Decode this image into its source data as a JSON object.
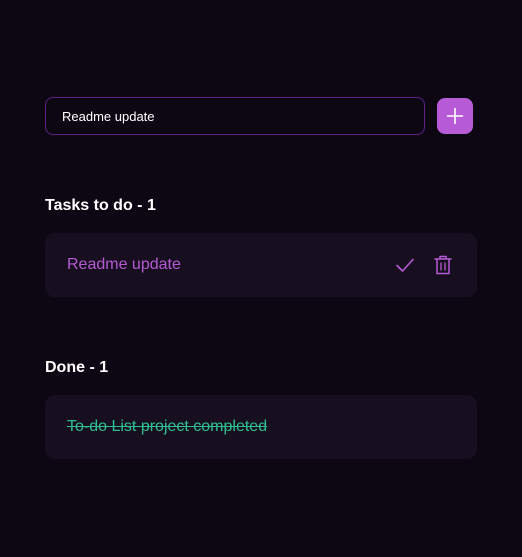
{
  "input": {
    "value": "Readme update",
    "placeholder": ""
  },
  "add_button": {
    "icon": "plus-icon",
    "color": "#b75ad6"
  },
  "todo_section": {
    "title": "Tasks to do - 1",
    "tasks": [
      {
        "text": "Readme update",
        "actions": [
          "check-icon",
          "trash-icon"
        ]
      }
    ]
  },
  "done_section": {
    "title": "Done - 1",
    "tasks": [
      {
        "text": "To-do List project completed"
      }
    ]
  },
  "colors": {
    "background": "#0d0714",
    "card": "#170f20",
    "accent": "#b75ad6",
    "done": "#2fbf8f",
    "input_border": "#5e1f86"
  }
}
